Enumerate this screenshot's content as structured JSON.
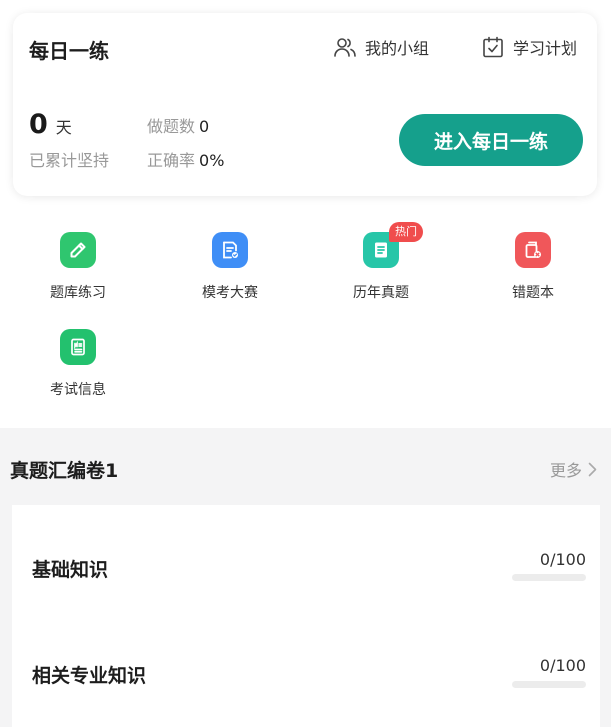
{
  "daily": {
    "title": "每日一练",
    "group_link": "我的小组",
    "plan_link": "学习计划",
    "days_value": "0",
    "days_unit": "天",
    "streak_label": "已累计坚持",
    "count_label": "做题数",
    "count_value": "0",
    "accuracy_label": "正确率",
    "accuracy_value": "0%",
    "enter_button": "进入每日一练"
  },
  "grid": {
    "hot_badge": "热门",
    "items": [
      {
        "label": "题库练习",
        "icon": "pencil-icon",
        "color": "#2fc66f"
      },
      {
        "label": "模考大赛",
        "icon": "exam-paper-icon",
        "color": "#3f8ef6"
      },
      {
        "label": "历年真题",
        "icon": "document-icon",
        "color": "#27c6a8"
      },
      {
        "label": "错题本",
        "icon": "wrong-book-icon",
        "color": "#f0575a"
      },
      {
        "label": "考试信息",
        "icon": "news-icon",
        "color": "#23c16e"
      }
    ]
  },
  "section": {
    "title": "真题汇编卷1",
    "more_label": "更多",
    "subjects": [
      {
        "name": "基础知识",
        "progress_text": "0/100",
        "progress": 0
      },
      {
        "name": "相关专业知识",
        "progress_text": "0/100",
        "progress": 0
      }
    ]
  },
  "colors": {
    "accent": "#15a08c",
    "hot_badge": "#f04d4d"
  }
}
